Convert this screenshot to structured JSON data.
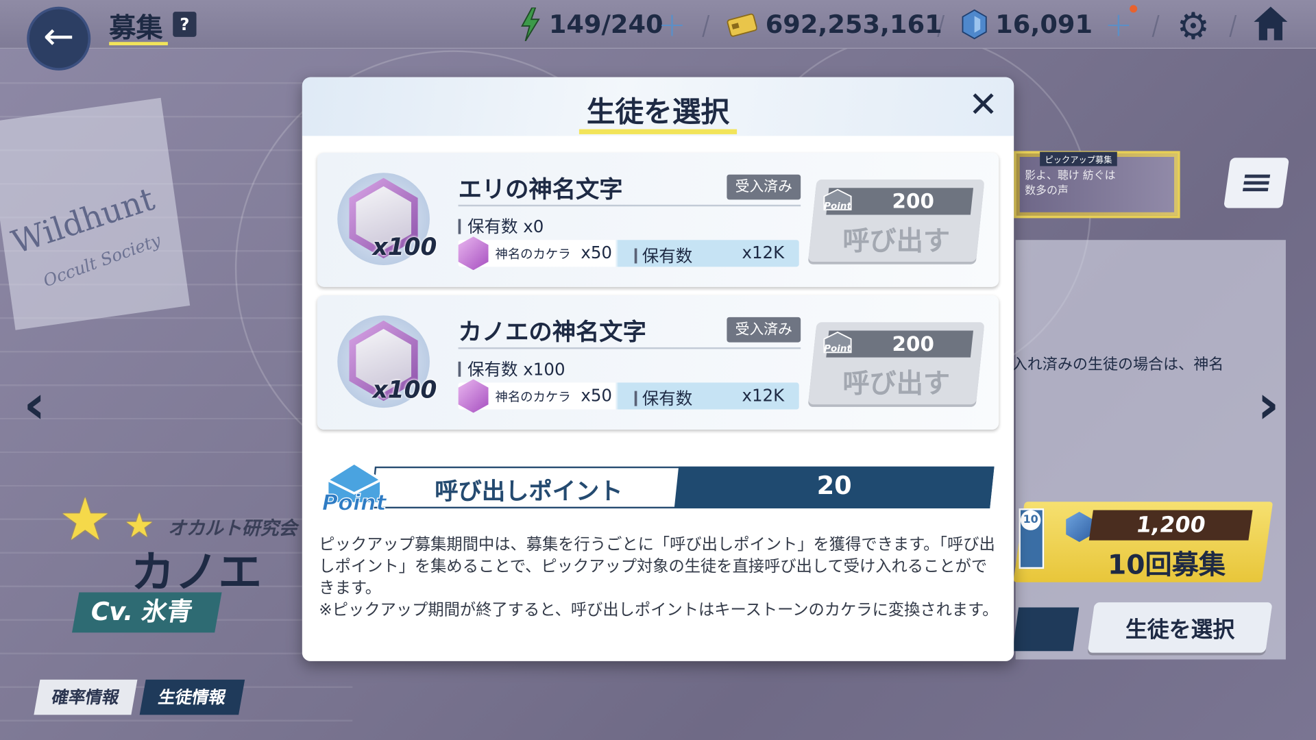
{
  "topbar": {
    "title": "募集",
    "help_label": "?",
    "ap": "149/240",
    "credits": "692,253,161",
    "gems": "16,091"
  },
  "modal": {
    "title": "生徒を選択",
    "items": [
      {
        "name": "エリの神名文字",
        "portrait_qty": "x100",
        "status": "受入済み",
        "held": "保有数 x0",
        "material_name": "神名のカケラ",
        "material_qty": "x50",
        "material_held_label": "保有数",
        "material_held_value": "x12K",
        "cost_icon_text": "Point",
        "cost": "200",
        "button_label": "呼び出す"
      },
      {
        "name": "カノエの神名文字",
        "portrait_qty": "x100",
        "status": "受入済み",
        "held": "保有数 x100",
        "material_name": "神名のカケラ",
        "material_qty": "x50",
        "material_held_label": "保有数",
        "material_held_value": "x12K",
        "cost_icon_text": "Point",
        "cost": "200",
        "button_label": "呼び出す"
      }
    ],
    "points": {
      "icon_text": "Point",
      "label": "呼び出しポイント",
      "value": "20"
    },
    "description": [
      "ピックアップ募集期間中は、募集を行うごとに「呼び出しポイント」を獲得できます。「呼び出しポイント」を集めることで、ピックアップ対象の生徒を直接呼び出して受け入れることができます。",
      "※ピックアップ期間が終了すると、呼び出しポイントはキーストーンのカケラに変換されます。"
    ]
  },
  "background": {
    "club": "オカルト研究会",
    "character": "カノエ",
    "cv": "Cv. 氷青",
    "banner_tag": "ピックアップ募集",
    "banner_text": "影よ、聴け 紡ぐは 数多の声",
    "right_text": "入れ済みの生徒の場合は、神名",
    "recruit_badge": "10",
    "recruit_cost": "1,200",
    "recruit_label": "10回募集",
    "select_student": "生徒を選択",
    "tab_rates": "確率情報",
    "tab_student": "生徒情報",
    "book_text": "Wildhunt",
    "book_sub": "Occult Society"
  },
  "colors": {
    "accent_yellow": "#f2e45a",
    "navy": "#1e2a44",
    "points_fill": "#1f4a70"
  }
}
